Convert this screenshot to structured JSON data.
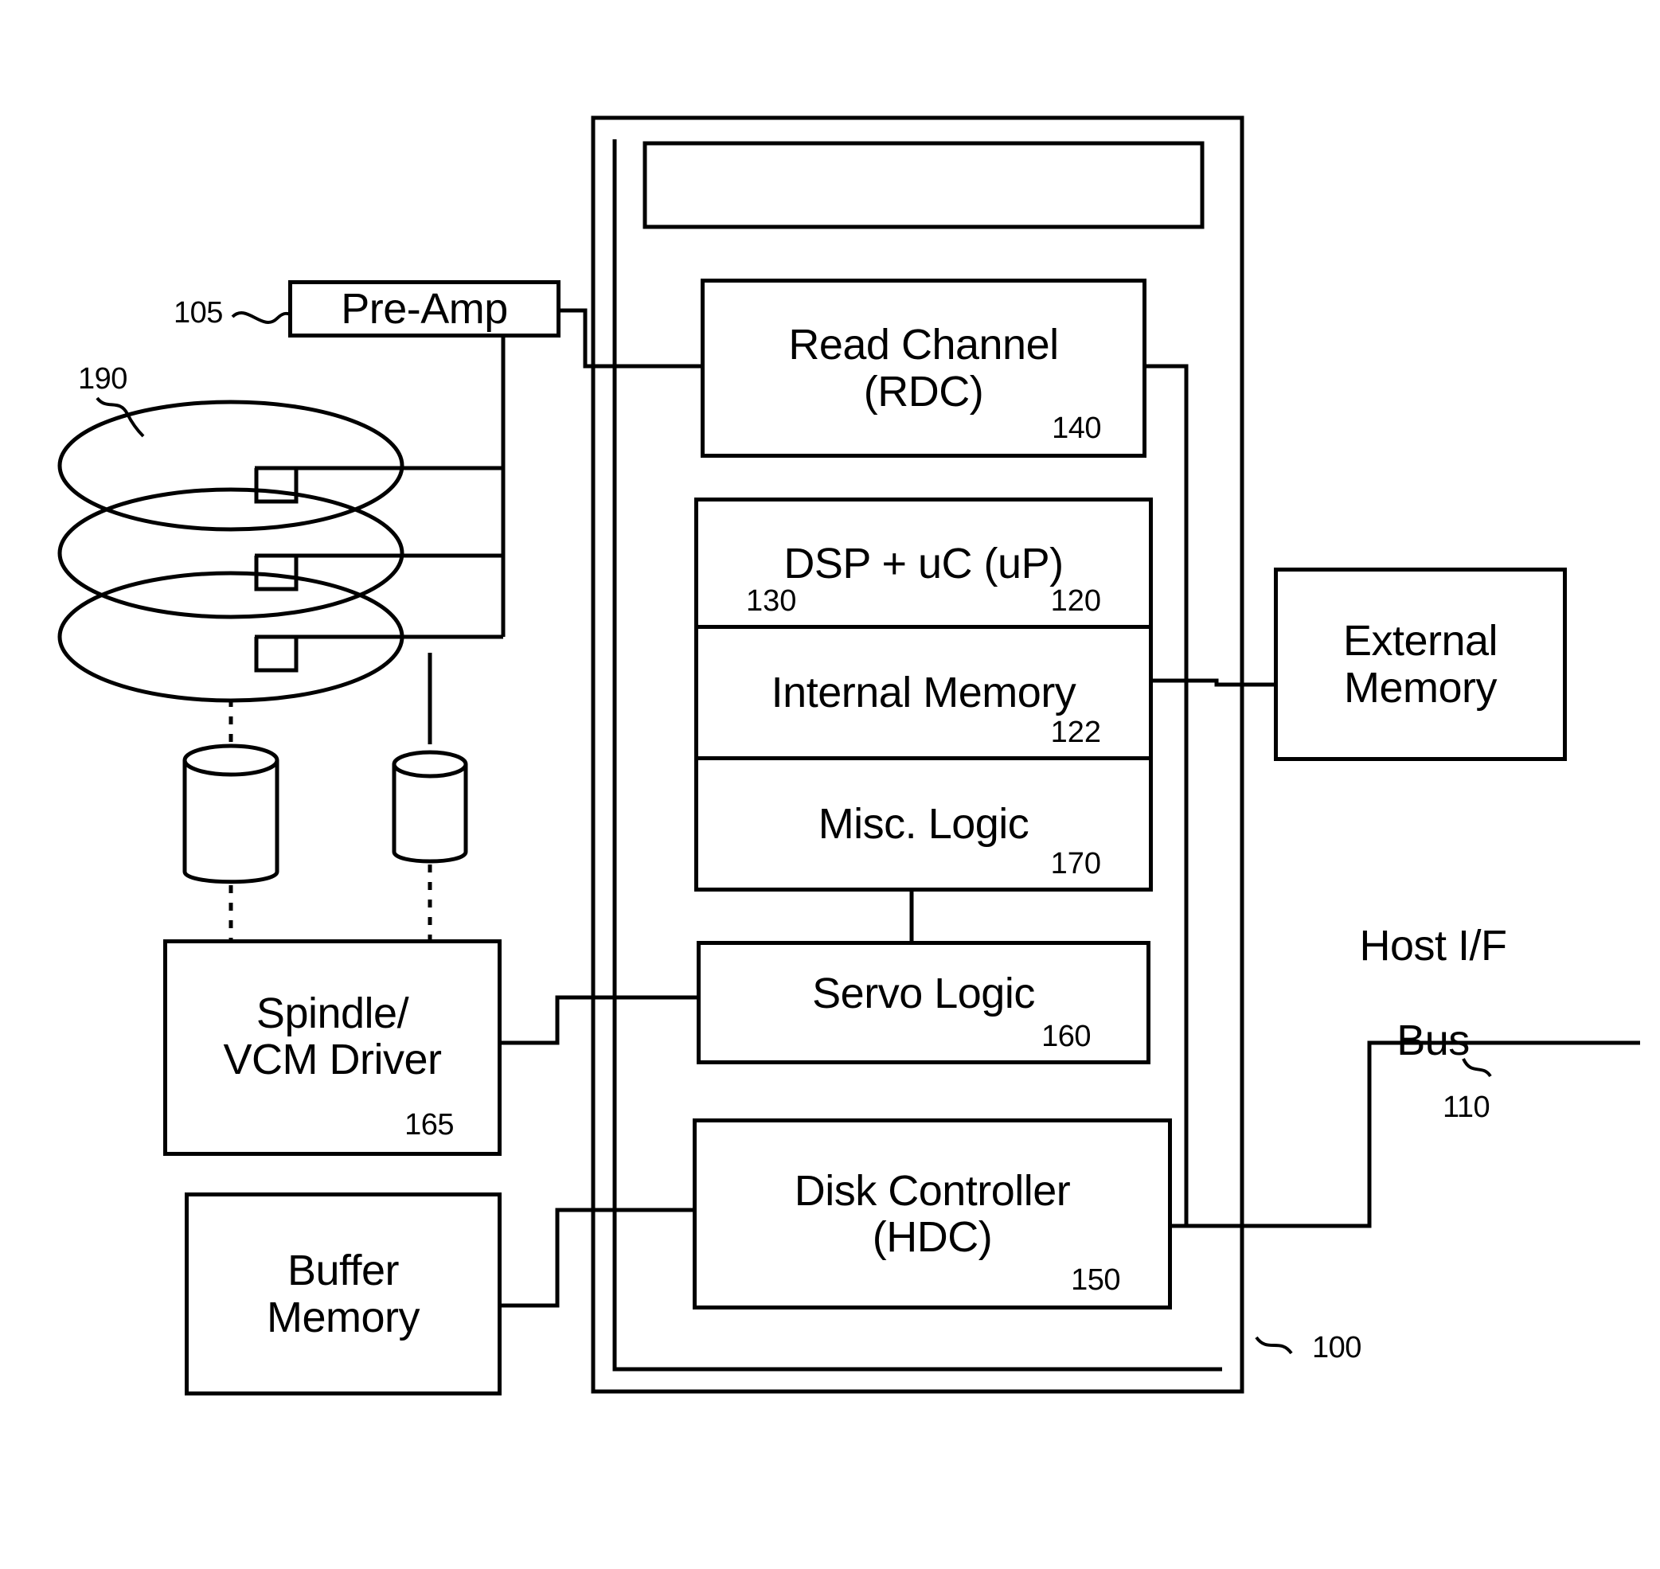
{
  "figure": {
    "type": "hard-disk-drive-block-diagram",
    "blocks": [
      {
        "id": "pre-amp",
        "label": "Pre-Amp",
        "ref": "105"
      },
      {
        "id": "read-channel",
        "label": "Read Channel\n(RDC)",
        "ref": "140"
      },
      {
        "id": "dsp-uc",
        "label": "DSP + uC (uP)",
        "ref_left": "130",
        "ref_right": "120"
      },
      {
        "id": "internal-memory",
        "label": "Internal Memory",
        "ref": "122"
      },
      {
        "id": "misc-logic",
        "label": "Misc. Logic",
        "ref": "170"
      },
      {
        "id": "servo-logic",
        "label": "Servo Logic",
        "ref": "160"
      },
      {
        "id": "disk-controller",
        "label": "Disk Controller\n(HDC)",
        "ref": "150"
      },
      {
        "id": "spindle-vcm",
        "label": "Spindle/\nVCM Driver",
        "ref": "165"
      },
      {
        "id": "buffer-memory",
        "label": "Buffer\nMemory",
        "ref": ""
      },
      {
        "id": "external-memory",
        "label": "External\nMemory",
        "ref": ""
      }
    ],
    "labels": {
      "pre_amp": "Pre-Amp",
      "read_channel": "Read Channel",
      "read_channel_abbrev": "(RDC)",
      "dsp_uc": "DSP + uC (uP)",
      "internal_memory": "Internal Memory",
      "misc_logic": "Misc. Logic",
      "servo_logic": "Servo Logic",
      "disk_controller": "Disk Controller",
      "disk_controller_abbrev": "(HDC)",
      "spindle_vcm_line1": "Spindle/",
      "spindle_vcm_line2": "VCM Driver",
      "buffer_memory_line1": "Buffer",
      "buffer_memory_line2": "Memory",
      "external_memory_line1": "External",
      "external_memory_line2": "Memory",
      "host_if_bus_line1": "Host I/F",
      "host_if_bus_line2": "Bus"
    },
    "reference_numerals": {
      "disk_stack": "190",
      "pre_amp": "105",
      "dsp": "130",
      "microcontroller": "120",
      "internal_memory": "122",
      "read_channel": "140",
      "disk_controller": "150",
      "servo_logic": "160",
      "spindle_vcm_driver": "165",
      "misc_logic": "170",
      "host_if_bus": "110",
      "drive_assembly": "100"
    },
    "colors": {
      "ink": "#000000",
      "paper": "#ffffff"
    }
  }
}
